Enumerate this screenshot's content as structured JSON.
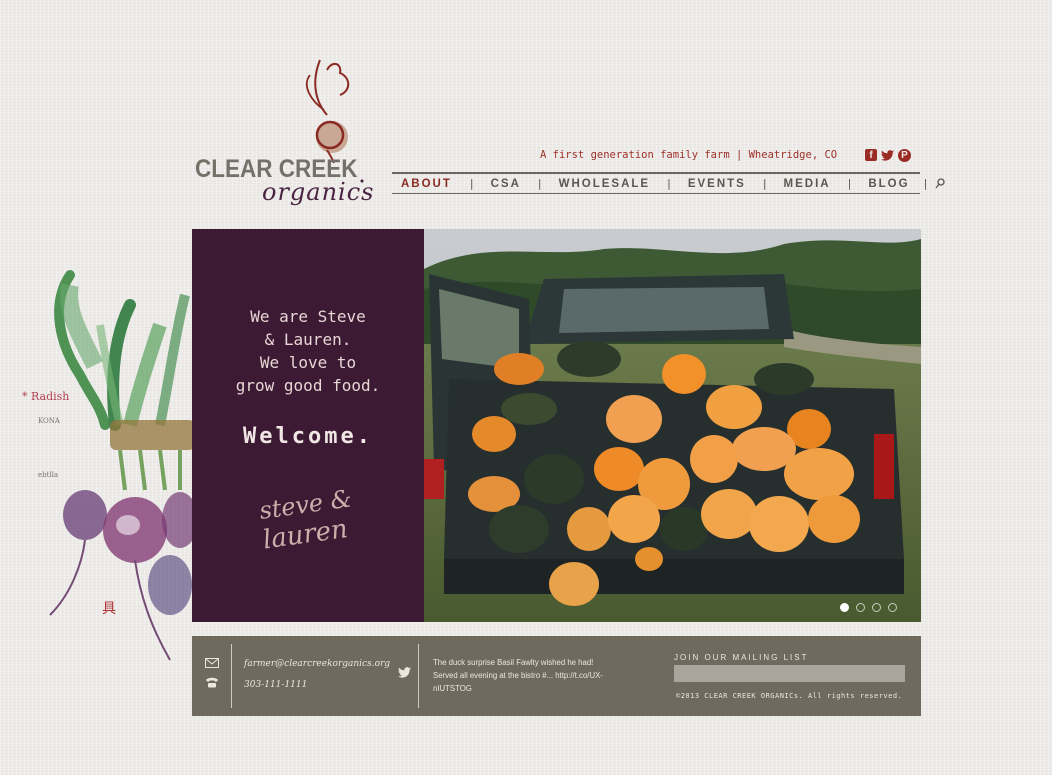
{
  "brand": {
    "logo_line1": "CLEAR CREEK",
    "logo_line2": "organics",
    "tagline": "A first generation family farm   |   Wheatridge, CO",
    "accent_color": "#9a2b25",
    "plum_color": "#3d1a34"
  },
  "social": [
    {
      "name": "facebook-icon",
      "glyph": "f"
    },
    {
      "name": "twitter-icon",
      "glyph": "🐦"
    },
    {
      "name": "pinterest-icon",
      "glyph": "P"
    }
  ],
  "nav": {
    "items": [
      "ABOUT",
      "CSA",
      "WHOLESALE",
      "EVENTS",
      "MEDIA",
      "BLOG"
    ],
    "separator": "|",
    "search_icon": "search-icon"
  },
  "hero": {
    "line1": "We are Steve",
    "line2": "& Lauren.",
    "line3": "We love to",
    "line4": "grow good food.",
    "welcome": "Welcome.",
    "signature_line1": "steve &",
    "signature_line2": "lauren"
  },
  "slider": {
    "count": 4,
    "active": 0
  },
  "footer": {
    "email": "farmer@clearcreekorganics.org",
    "phone": "303-111-1111",
    "tweet_line1": "The duck surprise Basil Fawlty wished he had!",
    "tweet_line2": "Served all evening at the bistro #... http://t.co/UX-",
    "tweet_line3": "nIUTSTOG",
    "mailing_label": "JOIN OUR MAILING LIST",
    "mailing_placeholder": "",
    "copyright": "©2013 CLEAR CREEK ORGANICs. All rights reserved."
  }
}
